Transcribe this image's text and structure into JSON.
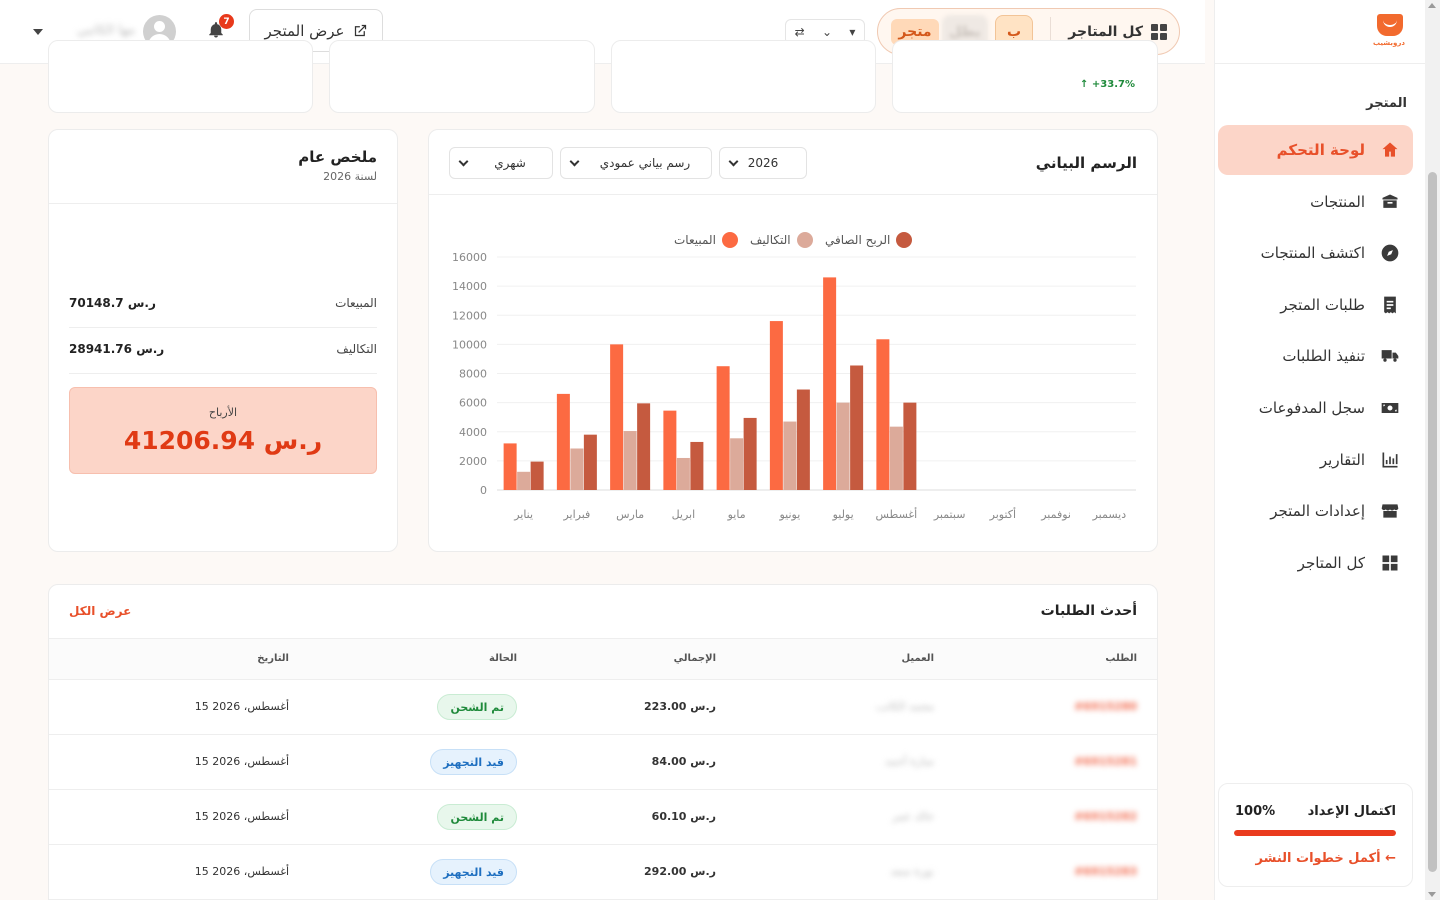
{
  "colors": {
    "accent": "#e8502a",
    "sales": "#fc6a42",
    "costs": "#dcaa9a",
    "profit": "#c55a3f",
    "success": "#1f8a3b",
    "info": "#1e6fc0"
  },
  "sidebar": {
    "logo_text": "دروبشيب",
    "section_title": "المتجر",
    "items": [
      {
        "label": "لوحة التحكم",
        "icon": "home-icon",
        "active": true
      },
      {
        "label": "المنتجات",
        "icon": "box-icon",
        "active": false
      },
      {
        "label": "اكتشف المنتجات",
        "icon": "compass-icon",
        "active": false
      },
      {
        "label": "طلبات المتجر",
        "icon": "receipt-icon",
        "active": false
      },
      {
        "label": "تنفيذ الطلبات",
        "icon": "truck-icon",
        "active": false
      },
      {
        "label": "سجل المدفوعات",
        "icon": "money-icon",
        "active": false
      },
      {
        "label": "التقارير",
        "icon": "bar-chart-icon",
        "active": false
      },
      {
        "label": "إعدادات المتجر",
        "icon": "store-icon",
        "active": false
      },
      {
        "label": "كل المتاجر",
        "icon": "grid-icon",
        "active": false
      }
    ],
    "setup": {
      "title": "اكتمال الإعداد",
      "percent": "100%",
      "progress": 1.0,
      "link": "أكمل خطوات النشر ←"
    }
  },
  "header": {
    "all_stores": "كل المتاجر",
    "chip_b": "ب",
    "chip_blurred": "بطل",
    "chip_store": "متجر",
    "view_store": "عرض المتجر",
    "notifications_count": "7",
    "user_name": "مها الكاتبي"
  },
  "stats": {
    "change": "+33.7%"
  },
  "chart": {
    "title": "الرسم البياني",
    "year_select": "2026",
    "type_select": "رسم بياني عمودي",
    "period_select": "شهري",
    "legend": {
      "sales": "المبيعات",
      "costs": "التكاليف",
      "profit": "الربح الصافي"
    }
  },
  "chart_data": {
    "type": "bar",
    "categories": [
      "يناير",
      "فبراير",
      "مارس",
      "ابريل",
      "مايو",
      "يونيو",
      "يوليو",
      "أغسطس",
      "سبتمبر",
      "أكتوبر",
      "نوفمبر",
      "ديسمبر"
    ],
    "series": [
      {
        "name": "المبيعات",
        "values": [
          3200,
          6600,
          10000,
          5450,
          8500,
          11600,
          14600,
          10350,
          0,
          0,
          0,
          0
        ]
      },
      {
        "name": "التكاليف",
        "values": [
          1250,
          2850,
          4050,
          2200,
          3550,
          4700,
          6000,
          4350,
          0,
          0,
          0,
          0
        ]
      },
      {
        "name": "الربح الصافي",
        "values": [
          1950,
          3800,
          5950,
          3300,
          4950,
          6900,
          8550,
          6000,
          0,
          0,
          0,
          0
        ]
      }
    ],
    "ylim": [
      0,
      16000
    ],
    "yticks": [
      "0",
      "2000",
      "4000",
      "6000",
      "8000",
      "10000",
      "12000",
      "14000",
      "16000"
    ],
    "grid": true,
    "legend_position": "top"
  },
  "summary": {
    "title": "ملخص عام",
    "subtitle": "لسنة 2026",
    "sales_label": "المبيعات",
    "sales_value": "70148.7 ر.س",
    "costs_label": "التكاليف",
    "costs_value": "28941.76 ر.س",
    "profit_label": "الأرباح",
    "profit_value": "41206.94 ر.س"
  },
  "orders": {
    "title": "أحدث الطلبات",
    "view_all": "عرض الكل",
    "columns": [
      "الطلب",
      "العميل",
      "الإجمالي",
      "الحالة",
      "التاريخ"
    ],
    "rows": [
      {
        "order": "#6915280",
        "customer": "محمد الكاتب",
        "total": "223.00 ر.س",
        "status": "تم الشحن",
        "status_type": "shipped",
        "date": "15 أغسطس، 2026"
      },
      {
        "order": "#6915281",
        "customer": "سارة أحمد",
        "total": "84.00 ر.س",
        "status": "قيد التجهيز",
        "status_type": "preparing",
        "date": "15 أغسطس، 2026"
      },
      {
        "order": "#6915282",
        "customer": "خالد عمر",
        "total": "60.10 ر.س",
        "status": "تم الشحن",
        "status_type": "shipped",
        "date": "15 أغسطس، 2026"
      },
      {
        "order": "#6915283",
        "customer": "نورة سعد",
        "total": "292.00 ر.س",
        "status": "قيد التجهيز",
        "status_type": "preparing",
        "date": "15 أغسطس، 2026"
      }
    ]
  }
}
